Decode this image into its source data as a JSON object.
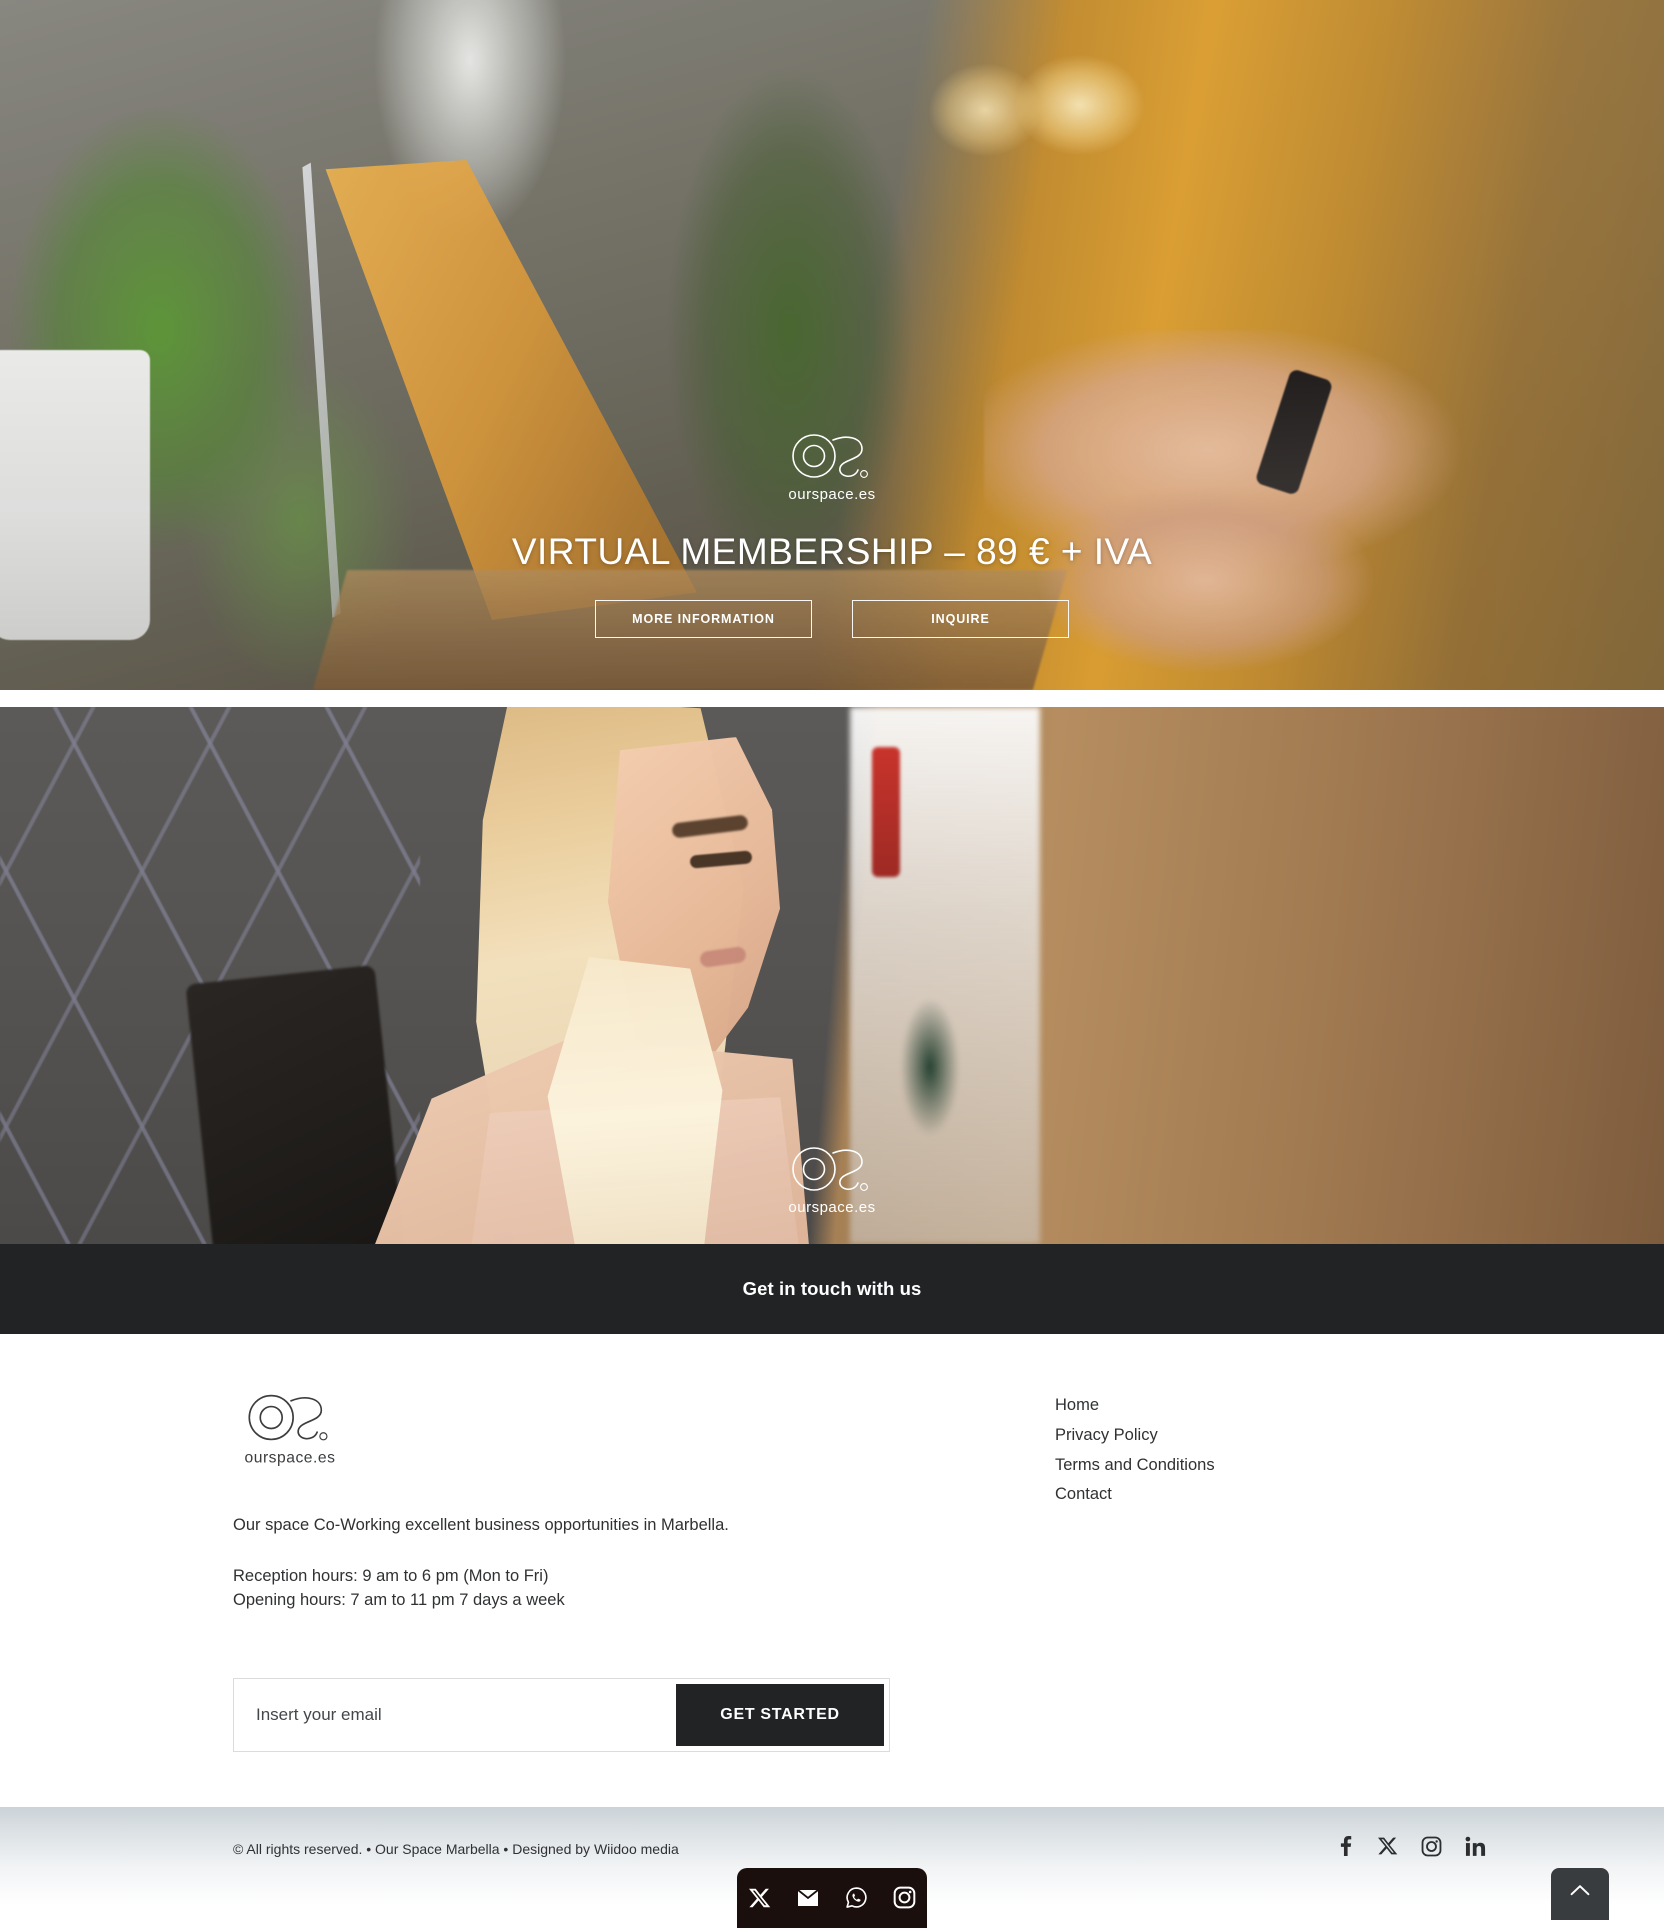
{
  "hero": {
    "logo_alt": "ourspace.es",
    "title": "VIRTUAL MEMBERSHIP – 89 € + IVA",
    "primary_button": "MORE INFORMATION",
    "secondary_button": "INQUIRE"
  },
  "secondary_hero": {
    "watermark_alt": "ourspace.es"
  },
  "contact_band": {
    "label": "Get in touch with us"
  },
  "footer": {
    "logo_alt": "ourspace.es",
    "description": "Our space Co-Working excellent business opportunities in Marbella.",
    "reception_hours": "Reception hours: 9 am to 6 pm (Mon to Fri)",
    "opening_hours": "Opening hours: 7 am to 11 pm 7 days a week",
    "nav": [
      {
        "label": "Home"
      },
      {
        "label": "Privacy Policy"
      },
      {
        "label": "Terms and Conditions"
      },
      {
        "label": "Contact"
      }
    ],
    "signup": {
      "placeholder": "Insert your email",
      "value": "",
      "button": "GET STARTED"
    }
  },
  "bottom_bar": {
    "copyright": "© All rights reserved. • Our Space Marbella • Designed by Wiidoo media",
    "social": [
      {
        "name": "facebook-icon"
      },
      {
        "name": "x-twitter-icon"
      },
      {
        "name": "instagram-icon"
      },
      {
        "name": "linkedin-icon"
      }
    ],
    "share_dock": [
      {
        "name": "x-twitter-icon"
      },
      {
        "name": "email-icon"
      },
      {
        "name": "whatsapp-icon"
      },
      {
        "name": "instagram-icon"
      }
    ],
    "scroll_top": {
      "name": "chevron-up-icon"
    }
  },
  "colors": {
    "dark_band": "#212325",
    "button_dark": "#212325",
    "text": "#2f3133",
    "share_dock": "#1a0f0c",
    "to_top": "#393c3f"
  }
}
